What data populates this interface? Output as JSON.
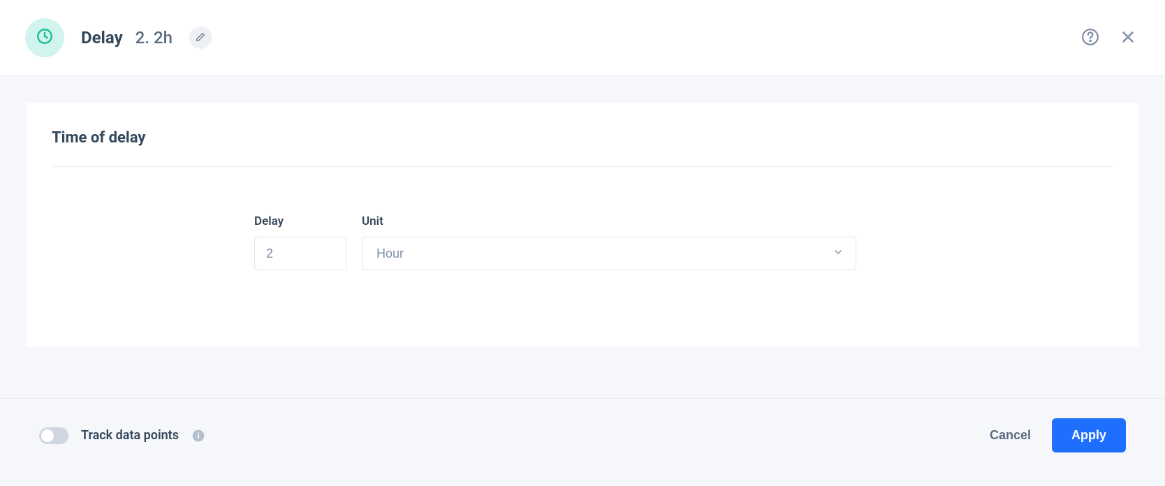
{
  "header": {
    "title": "Delay",
    "subtitle": "2. 2h"
  },
  "card": {
    "title": "Time of delay"
  },
  "form": {
    "delay_label": "Delay",
    "delay_value": "2",
    "unit_label": "Unit",
    "unit_value": "Hour"
  },
  "footer": {
    "toggle_label": "Track data points",
    "cancel_label": "Cancel",
    "apply_label": "Apply"
  }
}
